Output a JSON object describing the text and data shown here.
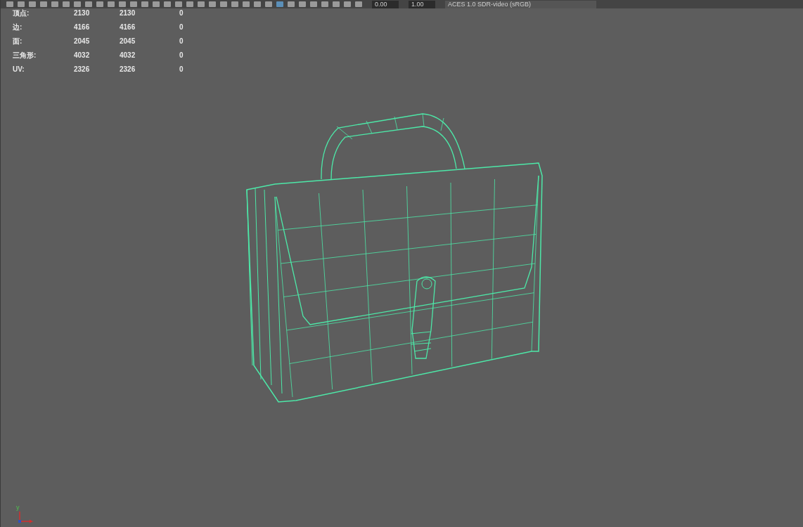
{
  "toolbar": {
    "fields": [
      "0.00",
      "1.00"
    ],
    "color_space": "ACES 1.0 SDR-video (sRGB)"
  },
  "stats": [
    {
      "label": "顶点:",
      "values": [
        "2130",
        "2130",
        "0"
      ]
    },
    {
      "label": "边:",
      "values": [
        "4166",
        "4166",
        "0"
      ]
    },
    {
      "label": "面:",
      "values": [
        "2045",
        "2045",
        "0"
      ]
    },
    {
      "label": "三角形:",
      "values": [
        "4032",
        "4032",
        "0"
      ]
    },
    {
      "label": "UV:",
      "values": [
        "2326",
        "2326",
        "0"
      ]
    }
  ],
  "axis": {
    "label": "y"
  }
}
